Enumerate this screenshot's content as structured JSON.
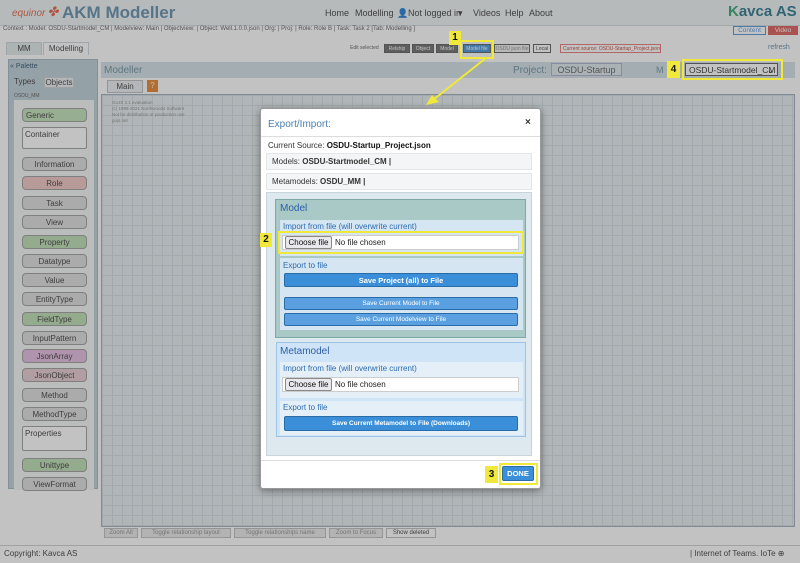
{
  "header": {
    "brand": "equinor",
    "app_title": "AKM Modeller",
    "nav": [
      "Home",
      "Modelling",
      "Not logged in",
      "Videos",
      "Help",
      "About"
    ],
    "kavca_k": "K",
    "kavca_rest": "avca AS",
    "content_tab": "Content",
    "video_tab": "Video"
  },
  "context_line": "Context : Model: OSDU-Startmodel_CM | Modelview: Main | Objectview: | Object: Well.1.0.0.json | Org: | Proj: | Role: Role B | Task: Task 2 [Tab: Modelling ]",
  "tabs": {
    "mm": "MM",
    "modelling": "Modelling"
  },
  "toolbar": {
    "edit_selected": "Edit selected",
    "buttons": [
      "Relship",
      "Object",
      "Model",
      "Model file",
      "OSDU json file",
      "Local"
    ],
    "current_source": "Current source: OSDU-Startup_Project.json",
    "refresh": "refresh"
  },
  "palette": {
    "title": "« Palette",
    "tab_types": "Types",
    "tab_objects": "Objects",
    "metamodel": "OSDU_MM",
    "items": [
      {
        "label": "Generic",
        "color": "#bfe0b6"
      },
      {
        "label": "Container",
        "color": "#ffffff"
      },
      {
        "label": "Information",
        "color": "#dcdcdc"
      },
      {
        "label": "Role",
        "color": "#f0c4c0"
      },
      {
        "label": "Task",
        "color": "#dcdcdc"
      },
      {
        "label": "View",
        "color": "#dcdcdc"
      },
      {
        "label": "Property",
        "color": "#b8dcb0"
      },
      {
        "label": "Datatype",
        "color": "#dcdcdc"
      },
      {
        "label": "Value",
        "color": "#dcdcdc"
      },
      {
        "label": "EntityType",
        "color": "#dcdcdc"
      },
      {
        "label": "FieldType",
        "color": "#b8dcb0"
      },
      {
        "label": "InputPattern",
        "color": "#dcdcdc"
      },
      {
        "label": "JsonArray",
        "color": "#e4b8e0"
      },
      {
        "label": "JsonObject",
        "color": "#e4c8d0"
      },
      {
        "label": "Method",
        "color": "#dcdcdc"
      },
      {
        "label": "MethodType",
        "color": "#dcdcdc"
      },
      {
        "label": "Properties",
        "color": "#ffffff"
      },
      {
        "label": "Unittype",
        "color": "#b8dcb0"
      },
      {
        "label": "ViewFormat",
        "color": "#dcdcdc"
      }
    ]
  },
  "modeller": {
    "title": "Modeller",
    "project_label": "Project:",
    "project_name": "OSDU-Startup",
    "model_label": "M",
    "model_select": "OSDU-Startmodel_CM",
    "main_tab": "Main",
    "q_tab": "?",
    "canvas_note": [
      "GoJS 2.1 evaluation",
      "(c) 1998-2021 Northwoods Software",
      "Not for distribution or production use",
      "gojs.net"
    ]
  },
  "bottom_buttons": [
    "Zoom All",
    "Toggle relationship layout",
    "Toggle relationships name",
    "Zoom to Focus",
    "Show deleted"
  ],
  "footer": {
    "copyright": "Copyright: Kavca AS",
    "right": "| Internet of Teams. IoTe"
  },
  "modal": {
    "title": "Export/Import:",
    "close": "×",
    "current_source_label": "Current Source:",
    "current_source_value": "OSDU-Startup_Project.json",
    "models_label": "Models:",
    "models_value": "OSDU-Startmodel_CM |",
    "metamodels_label": "Metamodels:",
    "metamodels_value": "OSDU_MM |",
    "model_section": {
      "heading": "Model",
      "import_label": "Import from file (will overwrite current)",
      "choose_file": "Choose file",
      "no_file": "No file chosen",
      "export_label": "Export to file",
      "btn_save_project": "Save Project (all) to File",
      "btn_save_model": "Save Current Model to File",
      "btn_save_modelview": "Save Current Modelview to File"
    },
    "metamodel_section": {
      "heading": "Metamodel",
      "import_label": "Import from file (will overwrite current)",
      "choose_file": "Choose file",
      "no_file": "No file chosen",
      "export_label": "Export to file",
      "btn_save_metamodel": "Save Current Metamodel to File (Downloads)"
    },
    "done": "DONE"
  },
  "annotations": [
    "1",
    "2",
    "3",
    "4"
  ],
  "colors": {
    "highlight": "#f0e83a",
    "accent_blue": "#3b8fd9",
    "title_blue": "#5a89a8"
  }
}
